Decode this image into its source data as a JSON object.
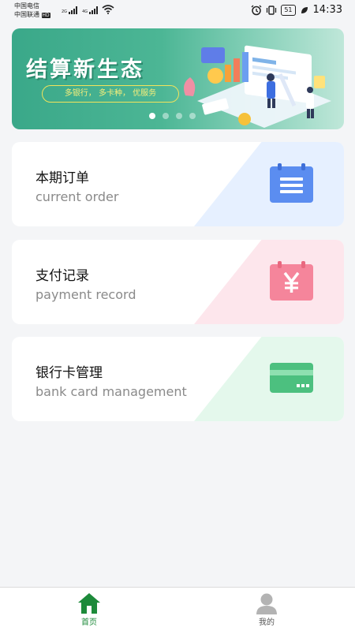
{
  "status_bar": {
    "carrier_1": "中国电信",
    "carrier_2": "中国联通",
    "hd": "HD",
    "net_2g": "2G",
    "net_4g": "4G",
    "battery": "51",
    "time": "14:33"
  },
  "banner": {
    "title": "结算新生态",
    "subtitle": "多银行，  多卡种，  优服务",
    "slides": 4,
    "active_slide": 0
  },
  "cards": [
    {
      "title": "本期订单",
      "subtitle": "current order",
      "icon": "order-list-icon",
      "accent": "#5b8df0",
      "tint": "#e6f0ff"
    },
    {
      "title": "支付记录",
      "subtitle": "payment record",
      "icon": "yuan-payment-icon",
      "accent": "#f5859b",
      "tint": "#fde6ec"
    },
    {
      "title": "银行卡管理",
      "subtitle": "bank card management",
      "icon": "bank-card-icon",
      "accent": "#4cc07f",
      "tint": "#e4f8ec"
    }
  ],
  "tab_bar": {
    "home_label": "首页",
    "mine_label": "我的",
    "active_color": "#1d8a3a",
    "inactive_color": "#555555"
  }
}
